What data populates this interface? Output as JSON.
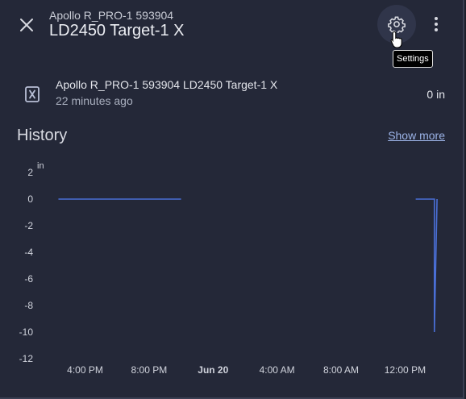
{
  "header": {
    "subtitle": "Apollo R_PRO-1 593904",
    "title": "LD2450 Target-1 X",
    "tooltip": "Settings"
  },
  "entity": {
    "name": "Apollo R_PRO-1 593904 LD2450 Target-1 X",
    "last_changed": "22 minutes ago",
    "state": "0 in",
    "icon": "alpha-x-box-outline-icon"
  },
  "history": {
    "title": "History",
    "show_more": "Show more"
  },
  "icons": {
    "close": "close-icon",
    "settings": "gear-icon",
    "more": "dots-vertical-icon"
  },
  "colors": {
    "background": "#242838",
    "line": "#4a6fd6",
    "link": "#9cb4e8"
  },
  "chart_data": {
    "type": "line",
    "ylabel": "in",
    "ylim": [
      -12,
      2
    ],
    "y_ticks": [
      2,
      0,
      -2,
      -4,
      -6,
      -8,
      -10,
      -12
    ],
    "x_ticks": [
      "4:00 PM",
      "8:00 PM",
      "Jun 20",
      "4:00 AM",
      "8:00 AM",
      "12:00 PM"
    ],
    "x_tick_bold": "Jun 20",
    "series": [
      {
        "segments": [
          {
            "x": [
              "2:20 PM",
              "10:00 PM"
            ],
            "y": [
              0,
              0
            ]
          },
          {
            "x": [
              "12:40 PM",
              "1:50 PM",
              "1:50 PM",
              "2:00 PM"
            ],
            "y": [
              0,
              0,
              -10,
              0
            ]
          }
        ]
      }
    ]
  }
}
